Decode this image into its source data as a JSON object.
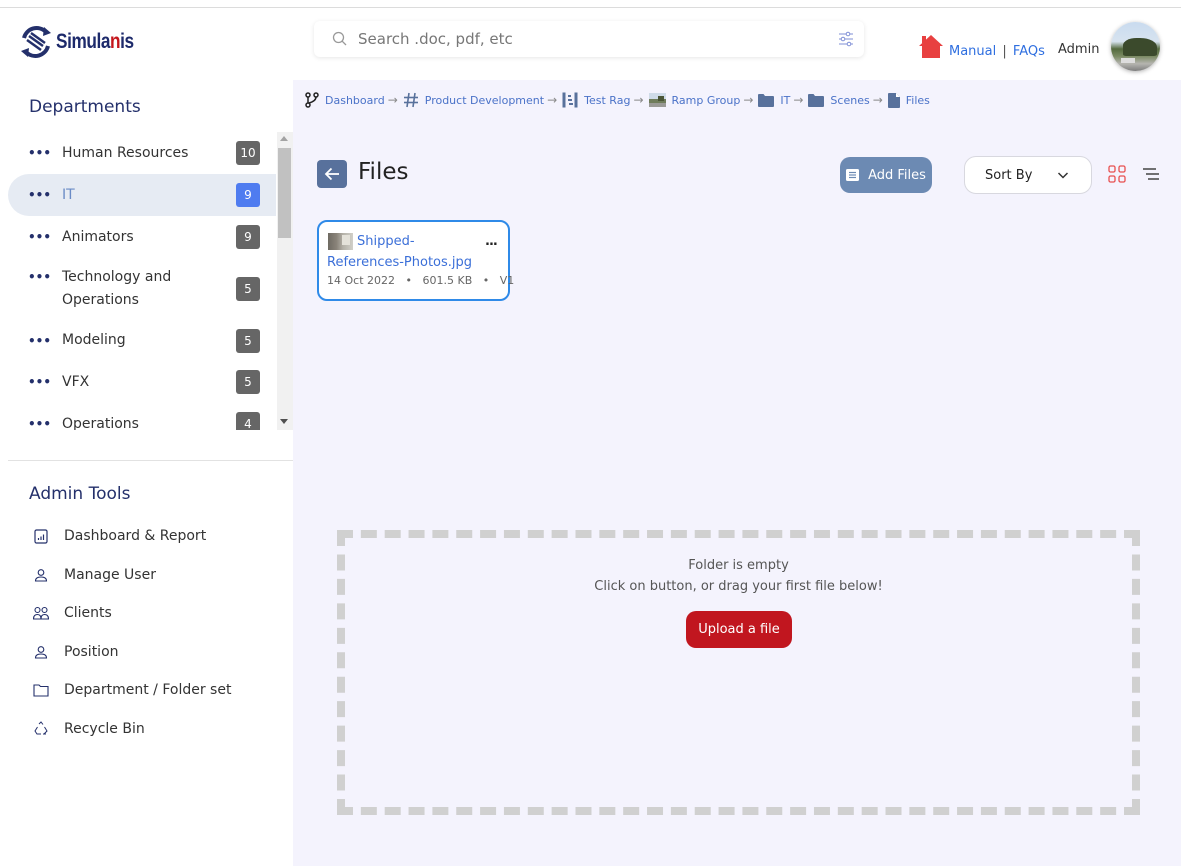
{
  "header": {
    "logo": {
      "text_main": "Simula",
      "text_accent": "n",
      "text_end": "is"
    },
    "search": {
      "placeholder": "Search .doc, pdf, etc",
      "value": ""
    },
    "help": {
      "manual_label": "Manual",
      "separator": "|",
      "faqs_label": "FAQs"
    },
    "user": {
      "name": "Admin"
    }
  },
  "sidebar": {
    "departments_title": "Departments",
    "departments": [
      {
        "label": "Human Resources",
        "count": "10",
        "active": false
      },
      {
        "label": "IT",
        "count": "9",
        "active": true
      },
      {
        "label": "Animators",
        "count": "9",
        "active": false
      },
      {
        "label": "Technology and Operations",
        "count": "5",
        "active": false
      },
      {
        "label": "Modeling",
        "count": "5",
        "active": false
      },
      {
        "label": "VFX",
        "count": "5",
        "active": false
      },
      {
        "label": "Operations",
        "count": "4",
        "active": false
      }
    ],
    "admin_title": "Admin Tools",
    "admin_tools": [
      {
        "label": "Dashboard & Report",
        "icon": "chart-report-icon"
      },
      {
        "label": "Manage User",
        "icon": "user-icon"
      },
      {
        "label": "Clients",
        "icon": "users-group-icon"
      },
      {
        "label": "Position",
        "icon": "user-icon"
      },
      {
        "label": "Department / Folder set",
        "icon": "folder-icon"
      },
      {
        "label": "Recycle Bin",
        "icon": "recycle-icon"
      }
    ]
  },
  "breadcrumb": [
    {
      "label": "Dashboard",
      "icon": "branch-icon"
    },
    {
      "label": "Product Development",
      "icon": "hash-icon"
    },
    {
      "label": "Test Rag",
      "icon": "structure-icon"
    },
    {
      "label": "Ramp Group",
      "icon": "group-thumbnail-icon"
    },
    {
      "label": "IT",
      "icon": "folder-icon"
    },
    {
      "label": "Scenes",
      "icon": "folder-icon"
    },
    {
      "label": "Files",
      "icon": "file-icon"
    }
  ],
  "breadcrumb_arrow": "→",
  "main": {
    "title": "Files",
    "add_files_label": "Add Files",
    "sort_by_label": "Sort By",
    "files": [
      {
        "name": "Shipped-References-Photos.jpg",
        "date": "14 Oct 2022",
        "size": "601.5 KB",
        "version": "V1"
      }
    ],
    "meta_separator": "•",
    "menu_glyph": "...",
    "empty_title": "Folder is empty",
    "empty_subtitle": "Click on button, or drag your first file below!",
    "upload_label": "Upload a file"
  },
  "colors": {
    "brand_navy": "#24306b",
    "brand_red": "#c4161c",
    "link_blue": "#3b6fd8",
    "active_badge": "#4f7cf0",
    "upload_red": "#c1161f",
    "add_files_bg": "#6c8ab3",
    "main_bg": "#f4f3fd"
  }
}
